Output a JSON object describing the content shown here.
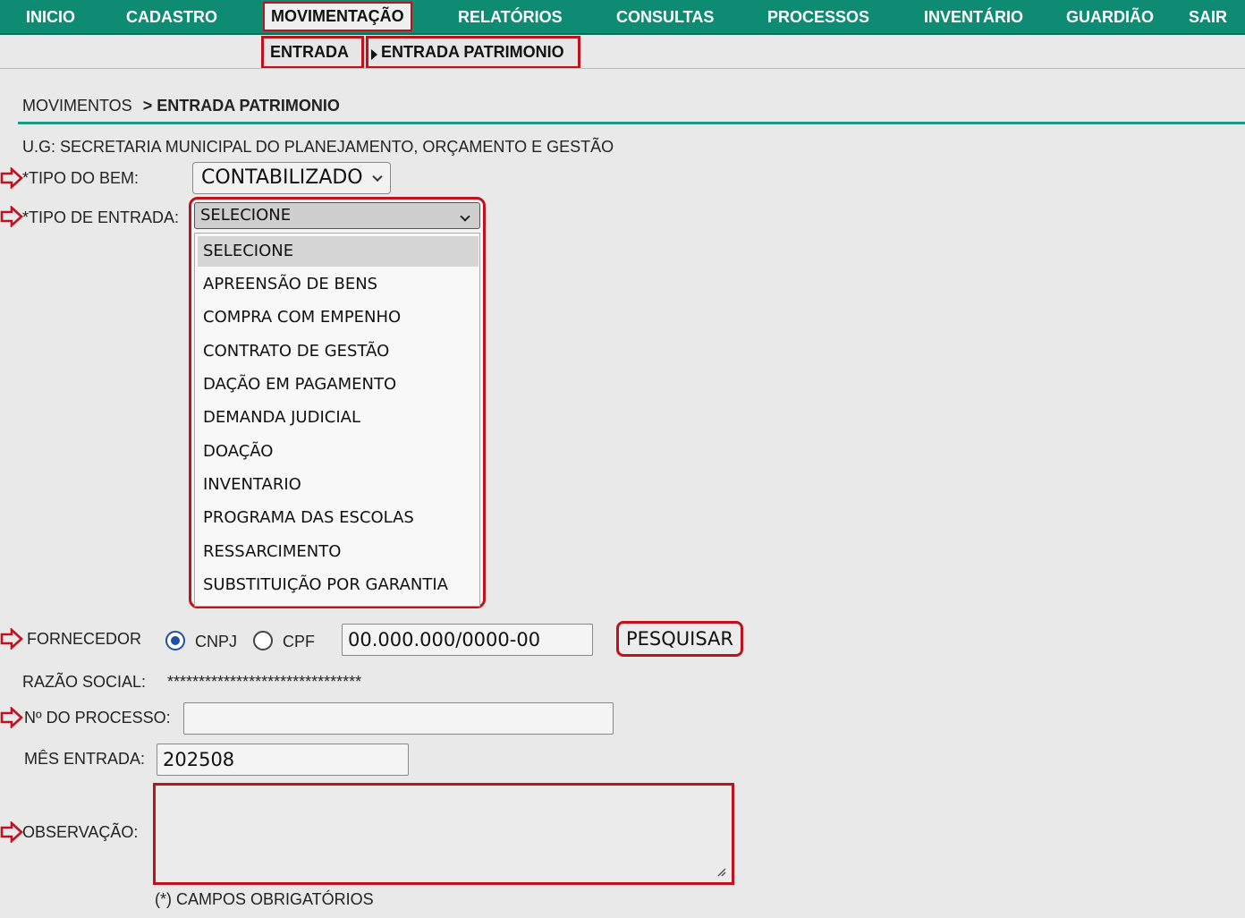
{
  "nav": {
    "items": [
      "INICIO",
      "CADASTRO",
      "MOVIMENTAÇÃO",
      "RELATÓRIOS",
      "CONSULTAS",
      "PROCESSOS",
      "INVENTÁRIO",
      "GUARDIÃO",
      "SAIR"
    ],
    "active": "MOVIMENTAÇÃO"
  },
  "submenu": {
    "entrada": "ENTRADA",
    "entrada_patrimonio": "ENTRADA PATRIMONIO"
  },
  "breadcrumb": {
    "parent": "MOVIMENTOS",
    "current": "> ENTRADA PATRIMONIO"
  },
  "ug": "U.G: SECRETARIA MUNICIPAL DO PLANEJAMENTO, ORÇAMENTO E GESTÃO",
  "form": {
    "tipo_bem_label": "*TIPO DO BEM:",
    "tipo_bem_value": "CONTABILIZADO",
    "tipo_entrada_label": "*TIPO DE ENTRADA:",
    "tipo_entrada_value": "SELECIONE",
    "tipo_entrada_options": [
      "SELECIONE",
      "APREENSÃO DE BENS",
      "COMPRA COM EMPENHO",
      "CONTRATO DE GESTÃO",
      "DAÇÃO EM PAGAMENTO",
      "DEMANDA JUDICIAL",
      "DOAÇÃO",
      "INVENTARIO",
      "PROGRAMA DAS ESCOLAS",
      "RESSARCIMENTO",
      "SUBSTITUIÇÃO POR GARANTIA"
    ],
    "fornecedor_label": "FORNECEDOR",
    "cnpj_label": "CNPJ",
    "cpf_label": "CPF",
    "documento_value": "00.000.000/0000-00",
    "pesquisar_label": "PESQUISAR",
    "razao_social_label": "RAZÃO SOCIAL:",
    "razao_social_value": "*******************************",
    "processo_label": "Nº DO PROCESSO:",
    "processo_value": "",
    "mes_entrada_label": "MÊS ENTRADA:",
    "mes_entrada_value": "202508",
    "observacao_label": "OBSERVAÇÃO:",
    "observacao_value": ""
  },
  "footer_note": "(*) CAMPOS OBRIGATÓRIOS",
  "colors": {
    "nav_bg": "#0e8c73",
    "highlight_red": "#c0121c",
    "rule_teal": "#1a9a82"
  }
}
